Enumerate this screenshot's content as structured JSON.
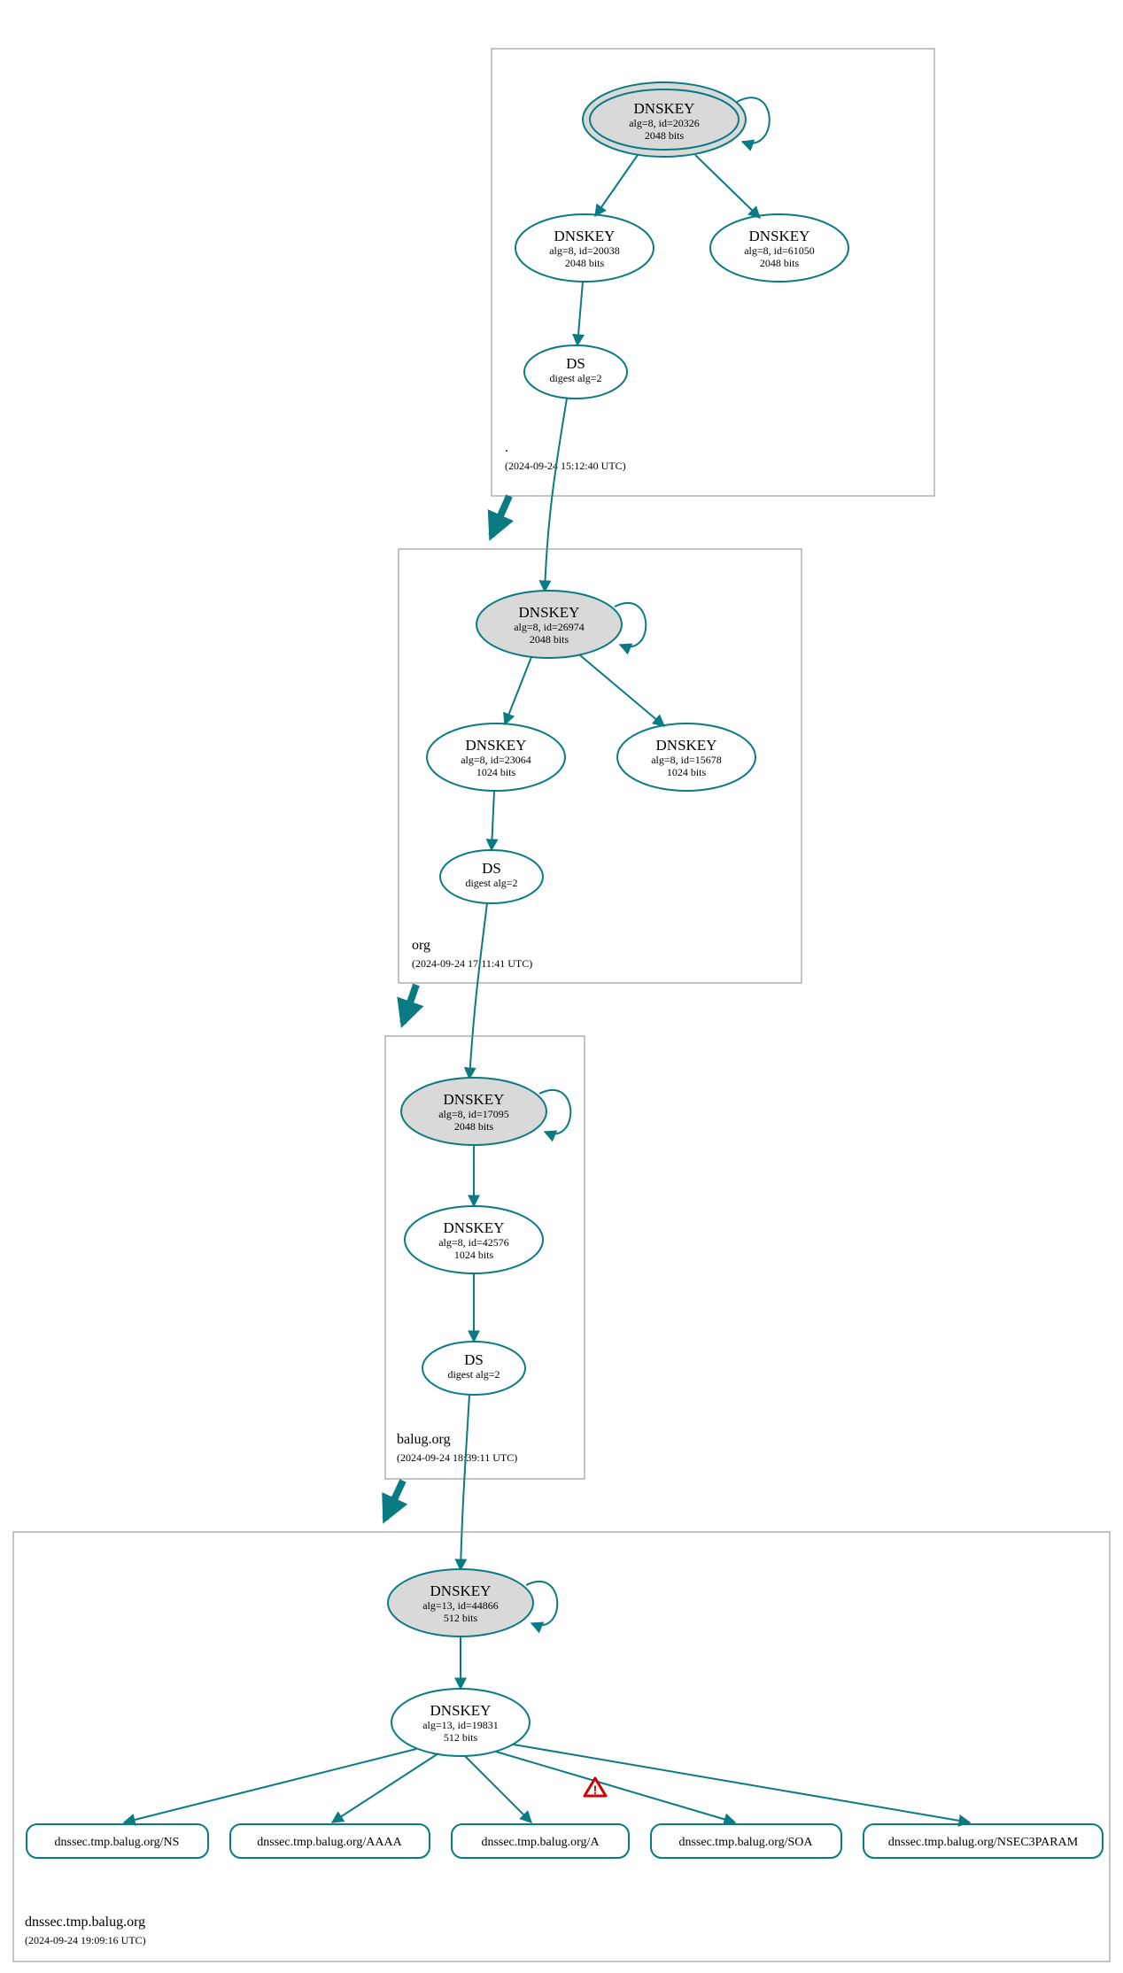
{
  "colors": {
    "teal": "#0a7b83",
    "gray_fill": "#d9d9d9",
    "box_stroke": "#888888",
    "warn": "#cc0000"
  },
  "zones": [
    {
      "name": ".",
      "timestamp": "(2024-09-24 15:12:40 UTC)"
    },
    {
      "name": "org",
      "timestamp": "(2024-09-24 17:11:41 UTC)"
    },
    {
      "name": "balug.org",
      "timestamp": "(2024-09-24 18:39:11 UTC)"
    },
    {
      "name": "dnssec.tmp.balug.org",
      "timestamp": "(2024-09-24 19:09:16 UTC)"
    }
  ],
  "zone1": {
    "ksk": {
      "title": "DNSKEY",
      "detail": "alg=8, id=20326",
      "bits": "2048 bits"
    },
    "zsk_l": {
      "title": "DNSKEY",
      "detail": "alg=8, id=20038",
      "bits": "2048 bits"
    },
    "zsk_r": {
      "title": "DNSKEY",
      "detail": "alg=8, id=61050",
      "bits": "2048 bits"
    },
    "ds": {
      "title": "DS",
      "detail": "digest alg=2"
    }
  },
  "zone2": {
    "ksk": {
      "title": "DNSKEY",
      "detail": "alg=8, id=26974",
      "bits": "2048 bits"
    },
    "zsk_l": {
      "title": "DNSKEY",
      "detail": "alg=8, id=23064",
      "bits": "1024 bits"
    },
    "zsk_r": {
      "title": "DNSKEY",
      "detail": "alg=8, id=15678",
      "bits": "1024 bits"
    },
    "ds": {
      "title": "DS",
      "detail": "digest alg=2"
    }
  },
  "zone3": {
    "ksk": {
      "title": "DNSKEY",
      "detail": "alg=8, id=17095",
      "bits": "2048 bits"
    },
    "zsk": {
      "title": "DNSKEY",
      "detail": "alg=8, id=42576",
      "bits": "1024 bits"
    },
    "ds": {
      "title": "DS",
      "detail": "digest alg=2"
    }
  },
  "zone4": {
    "ksk": {
      "title": "DNSKEY",
      "detail": "alg=13, id=44866",
      "bits": "512 bits"
    },
    "zsk": {
      "title": "DNSKEY",
      "detail": "alg=13, id=19831",
      "bits": "512 bits"
    },
    "rrsets": [
      "dnssec.tmp.balug.org/NS",
      "dnssec.tmp.balug.org/AAAA",
      "dnssec.tmp.balug.org/A",
      "dnssec.tmp.balug.org/SOA",
      "dnssec.tmp.balug.org/NSEC3PARAM"
    ],
    "warning_on_edge_index": 3
  }
}
